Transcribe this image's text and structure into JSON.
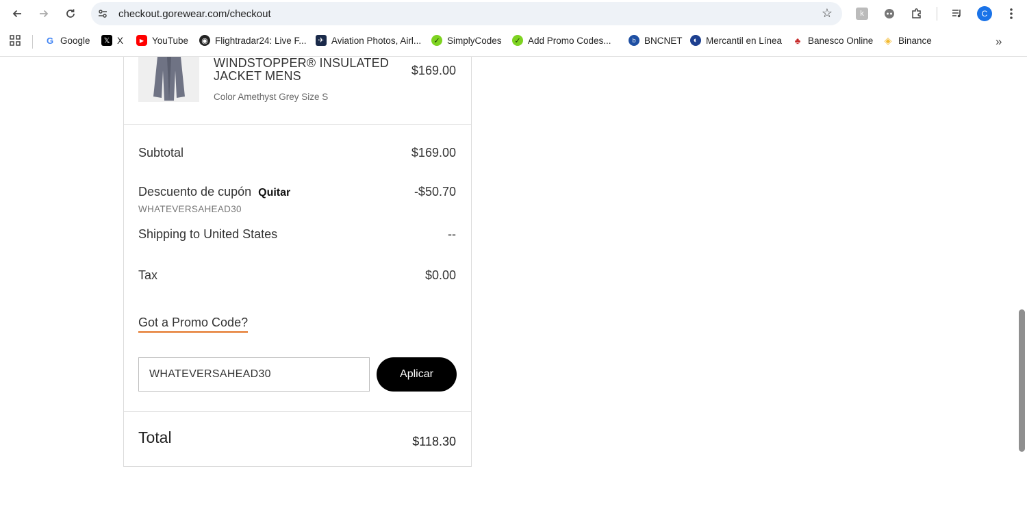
{
  "browser": {
    "url": "checkout.gorewear.com/checkout",
    "avatar_letter": "C"
  },
  "bookmarks": [
    {
      "label": "Google",
      "icon": "google-icon",
      "color": "#4285f4"
    },
    {
      "label": "X",
      "icon": "x-icon",
      "color": "#000000"
    },
    {
      "label": "YouTube",
      "icon": "youtube-icon",
      "color": "#ff0000"
    },
    {
      "label": "Flightradar24: Live F...",
      "icon": "flightradar-icon",
      "color": "#222222"
    },
    {
      "label": "Aviation Photos, Airl...",
      "icon": "aviation-icon",
      "color": "#1a2a4a"
    },
    {
      "label": "SimplyCodes",
      "icon": "simplycodes-icon",
      "color": "#7ed321"
    },
    {
      "label": "Add Promo Codes...",
      "icon": "simplycodes-icon",
      "color": "#7ed321"
    },
    {
      "label": "BNCNET",
      "icon": "bncnet-icon",
      "color": "#1e4fa3"
    },
    {
      "label": "Mercantil en Línea",
      "icon": "mercantil-icon",
      "color": "#1d3f8f"
    },
    {
      "label": "Banesco Online",
      "icon": "banesco-icon",
      "color": "#2e7d32"
    },
    {
      "label": "Binance",
      "icon": "binance-icon",
      "color": "#f3ba2f"
    }
  ],
  "product": {
    "name": "WINDSTOPPER® INSULATED JACKET MENS",
    "price": "$169.00",
    "meta": "Color Amethyst Grey  Size S"
  },
  "summary": {
    "subtotal_label": "Subtotal",
    "subtotal_value": "$169.00",
    "discount_label": "Descuento de cupón",
    "discount_remove": "Quitar",
    "discount_value": "-$50.70",
    "discount_code": "WHATEVERSAHEAD30",
    "shipping_label": "Shipping to United States",
    "shipping_value": "--",
    "tax_label": "Tax",
    "tax_value": "$0.00"
  },
  "promo": {
    "link_label": "Got a Promo Code?",
    "input_value": "WHATEVERSAHEAD30",
    "apply_label": "Aplicar"
  },
  "total": {
    "label": "Total",
    "value": "$118.30"
  }
}
